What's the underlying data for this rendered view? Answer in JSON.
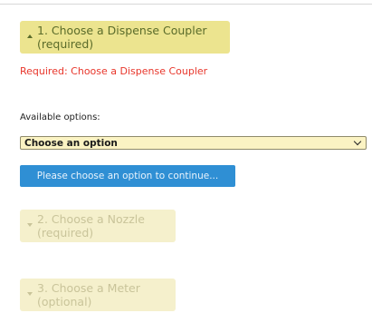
{
  "steps": [
    {
      "label": "1. Choose a Dispense Coupler (required)",
      "state": "expanded"
    },
    {
      "label": "2. Choose a Nozzle (required)",
      "state": "collapsed"
    },
    {
      "label": "3. Choose a Meter (optional)",
      "state": "collapsed"
    }
  ],
  "required_message": "Required: Choose a Dispense Coupler",
  "options": {
    "label": "Available options:",
    "selected": "Choose an option"
  },
  "continue_button": {
    "label": "Please choose an option to continue..."
  },
  "colors": {
    "active_header_bg": "#ece48f",
    "inactive_header_bg": "#f5f0cc",
    "error_text": "#e8362b",
    "button_bg": "#2f8fd4",
    "select_bg": "#fbf3c3"
  }
}
